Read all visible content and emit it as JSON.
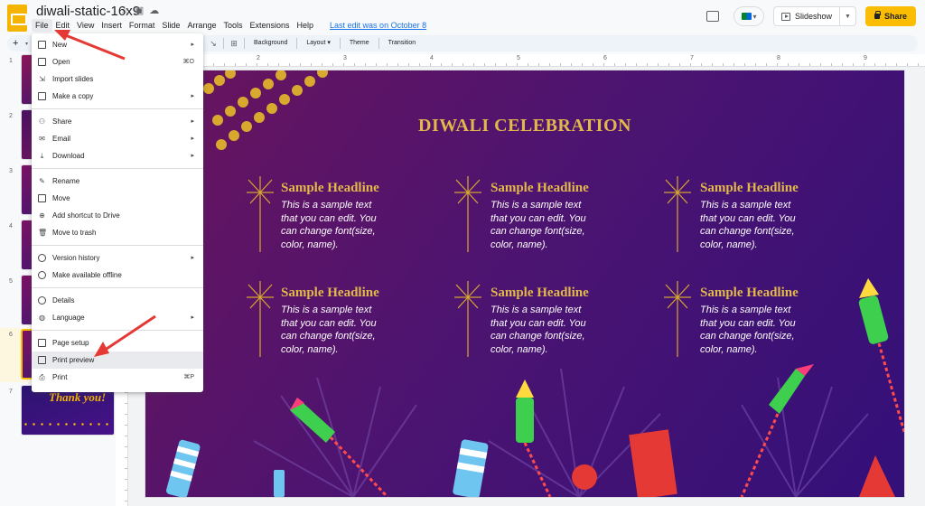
{
  "header": {
    "doc_title": "diwali-static-16x9",
    "last_edit": "Last edit was on October 8",
    "slideshow_label": "Slideshow",
    "share_label": "Share"
  },
  "menubar": [
    "File",
    "Edit",
    "View",
    "Insert",
    "Format",
    "Slide",
    "Arrange",
    "Tools",
    "Extensions",
    "Help"
  ],
  "toolbar": {
    "background": "Background",
    "layout": "Layout",
    "theme": "Theme",
    "transition": "Transition"
  },
  "filmstrip": {
    "numbers": [
      "1",
      "2",
      "3",
      "4",
      "5",
      "6",
      "7"
    ],
    "thanks_text": "Thank you!",
    "selected": "6"
  },
  "ruler": {
    "marks": [
      "2",
      "3",
      "4",
      "5",
      "6",
      "7",
      "8",
      "9"
    ]
  },
  "file_menu": {
    "items": [
      {
        "label": "New",
        "icon": "new-slides-icon",
        "submenu": true
      },
      {
        "label": "Open",
        "icon": "open-folder-icon",
        "shortcut": "⌘O"
      },
      {
        "label": "Import slides",
        "icon": "import-icon"
      },
      {
        "label": "Make a copy",
        "icon": "copy-icon",
        "submenu": true
      },
      {
        "label": "Share",
        "icon": "share-person-icon",
        "submenu": true
      },
      {
        "label": "Email",
        "icon": "email-icon",
        "submenu": true
      },
      {
        "label": "Download",
        "icon": "download-icon",
        "submenu": true
      },
      {
        "label": "Rename",
        "icon": "rename-icon"
      },
      {
        "label": "Move",
        "icon": "move-icon"
      },
      {
        "label": "Add shortcut to Drive",
        "icon": "drive-shortcut-icon"
      },
      {
        "label": "Move to trash",
        "icon": "trash-icon"
      },
      {
        "label": "Version history",
        "icon": "history-icon",
        "submenu": true
      },
      {
        "label": "Make available offline",
        "icon": "offline-icon"
      },
      {
        "label": "Details",
        "icon": "info-icon"
      },
      {
        "label": "Language",
        "icon": "globe-icon",
        "submenu": true
      },
      {
        "label": "Page setup",
        "icon": "page-setup-icon"
      },
      {
        "label": "Print preview",
        "icon": "print-preview-icon",
        "highlighted": true
      },
      {
        "label": "Print",
        "icon": "print-icon",
        "shortcut": "⌘P"
      }
    ]
  },
  "slide": {
    "title": "DIWALI CELEBRATION",
    "blocks": [
      {
        "headline": "Sample Headline",
        "body": "This is a sample text that you can edit. You can change font(size, color, name)."
      },
      {
        "headline": "Sample Headline",
        "body": "This is a sample text that you can edit. You can change font(size, color, name)."
      },
      {
        "headline": "Sample Headline",
        "body": "This is a sample text that you can edit. You can change font(size, color, name)."
      },
      {
        "headline": "Sample Headline",
        "body": "This is a sample text that you can edit. You can change font(size, color, name)."
      },
      {
        "headline": "Sample Headline",
        "body": "This is a sample text that you can edit. You can change font(size, color, name)."
      },
      {
        "headline": "Sample Headline",
        "body": "This is a sample text that you can edit. You can change font(size, color, name)."
      }
    ]
  },
  "colors": {
    "accent": "#fbbc04",
    "title_gold": "#e2b84b",
    "slide_bg_start": "#6a145c",
    "slide_bg_end": "#331079",
    "arrow_red": "#e53935",
    "link_blue": "#1a73e8"
  }
}
